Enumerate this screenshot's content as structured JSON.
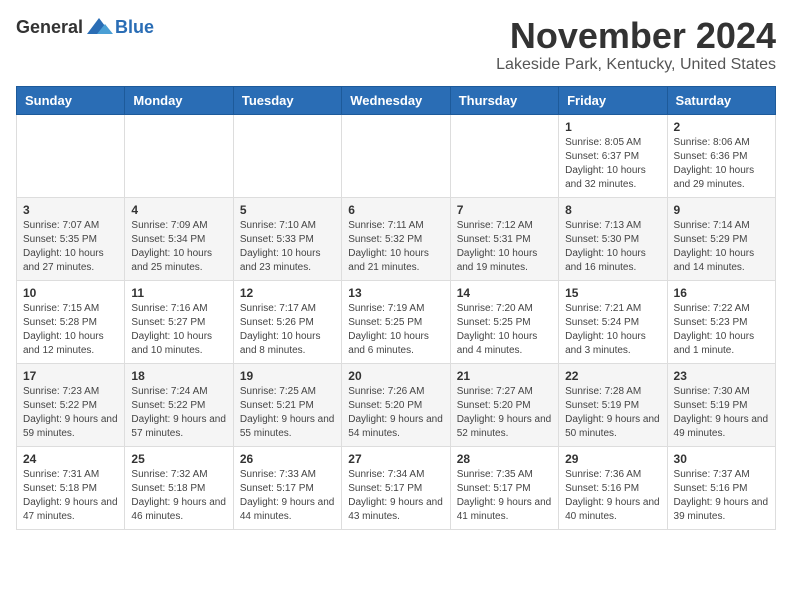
{
  "header": {
    "logo_general": "General",
    "logo_blue": "Blue",
    "month_title": "November 2024",
    "location": "Lakeside Park, Kentucky, United States"
  },
  "weekdays": [
    "Sunday",
    "Monday",
    "Tuesday",
    "Wednesday",
    "Thursday",
    "Friday",
    "Saturday"
  ],
  "weeks": [
    [
      {
        "day": "",
        "info": ""
      },
      {
        "day": "",
        "info": ""
      },
      {
        "day": "",
        "info": ""
      },
      {
        "day": "",
        "info": ""
      },
      {
        "day": "",
        "info": ""
      },
      {
        "day": "1",
        "info": "Sunrise: 8:05 AM\nSunset: 6:37 PM\nDaylight: 10 hours and 32 minutes."
      },
      {
        "day": "2",
        "info": "Sunrise: 8:06 AM\nSunset: 6:36 PM\nDaylight: 10 hours and 29 minutes."
      }
    ],
    [
      {
        "day": "3",
        "info": "Sunrise: 7:07 AM\nSunset: 5:35 PM\nDaylight: 10 hours and 27 minutes."
      },
      {
        "day": "4",
        "info": "Sunrise: 7:09 AM\nSunset: 5:34 PM\nDaylight: 10 hours and 25 minutes."
      },
      {
        "day": "5",
        "info": "Sunrise: 7:10 AM\nSunset: 5:33 PM\nDaylight: 10 hours and 23 minutes."
      },
      {
        "day": "6",
        "info": "Sunrise: 7:11 AM\nSunset: 5:32 PM\nDaylight: 10 hours and 21 minutes."
      },
      {
        "day": "7",
        "info": "Sunrise: 7:12 AM\nSunset: 5:31 PM\nDaylight: 10 hours and 19 minutes."
      },
      {
        "day": "8",
        "info": "Sunrise: 7:13 AM\nSunset: 5:30 PM\nDaylight: 10 hours and 16 minutes."
      },
      {
        "day": "9",
        "info": "Sunrise: 7:14 AM\nSunset: 5:29 PM\nDaylight: 10 hours and 14 minutes."
      }
    ],
    [
      {
        "day": "10",
        "info": "Sunrise: 7:15 AM\nSunset: 5:28 PM\nDaylight: 10 hours and 12 minutes."
      },
      {
        "day": "11",
        "info": "Sunrise: 7:16 AM\nSunset: 5:27 PM\nDaylight: 10 hours and 10 minutes."
      },
      {
        "day": "12",
        "info": "Sunrise: 7:17 AM\nSunset: 5:26 PM\nDaylight: 10 hours and 8 minutes."
      },
      {
        "day": "13",
        "info": "Sunrise: 7:19 AM\nSunset: 5:25 PM\nDaylight: 10 hours and 6 minutes."
      },
      {
        "day": "14",
        "info": "Sunrise: 7:20 AM\nSunset: 5:25 PM\nDaylight: 10 hours and 4 minutes."
      },
      {
        "day": "15",
        "info": "Sunrise: 7:21 AM\nSunset: 5:24 PM\nDaylight: 10 hours and 3 minutes."
      },
      {
        "day": "16",
        "info": "Sunrise: 7:22 AM\nSunset: 5:23 PM\nDaylight: 10 hours and 1 minute."
      }
    ],
    [
      {
        "day": "17",
        "info": "Sunrise: 7:23 AM\nSunset: 5:22 PM\nDaylight: 9 hours and 59 minutes."
      },
      {
        "day": "18",
        "info": "Sunrise: 7:24 AM\nSunset: 5:22 PM\nDaylight: 9 hours and 57 minutes."
      },
      {
        "day": "19",
        "info": "Sunrise: 7:25 AM\nSunset: 5:21 PM\nDaylight: 9 hours and 55 minutes."
      },
      {
        "day": "20",
        "info": "Sunrise: 7:26 AM\nSunset: 5:20 PM\nDaylight: 9 hours and 54 minutes."
      },
      {
        "day": "21",
        "info": "Sunrise: 7:27 AM\nSunset: 5:20 PM\nDaylight: 9 hours and 52 minutes."
      },
      {
        "day": "22",
        "info": "Sunrise: 7:28 AM\nSunset: 5:19 PM\nDaylight: 9 hours and 50 minutes."
      },
      {
        "day": "23",
        "info": "Sunrise: 7:30 AM\nSunset: 5:19 PM\nDaylight: 9 hours and 49 minutes."
      }
    ],
    [
      {
        "day": "24",
        "info": "Sunrise: 7:31 AM\nSunset: 5:18 PM\nDaylight: 9 hours and 47 minutes."
      },
      {
        "day": "25",
        "info": "Sunrise: 7:32 AM\nSunset: 5:18 PM\nDaylight: 9 hours and 46 minutes."
      },
      {
        "day": "26",
        "info": "Sunrise: 7:33 AM\nSunset: 5:17 PM\nDaylight: 9 hours and 44 minutes."
      },
      {
        "day": "27",
        "info": "Sunrise: 7:34 AM\nSunset: 5:17 PM\nDaylight: 9 hours and 43 minutes."
      },
      {
        "day": "28",
        "info": "Sunrise: 7:35 AM\nSunset: 5:17 PM\nDaylight: 9 hours and 41 minutes."
      },
      {
        "day": "29",
        "info": "Sunrise: 7:36 AM\nSunset: 5:16 PM\nDaylight: 9 hours and 40 minutes."
      },
      {
        "day": "30",
        "info": "Sunrise: 7:37 AM\nSunset: 5:16 PM\nDaylight: 9 hours and 39 minutes."
      }
    ]
  ]
}
